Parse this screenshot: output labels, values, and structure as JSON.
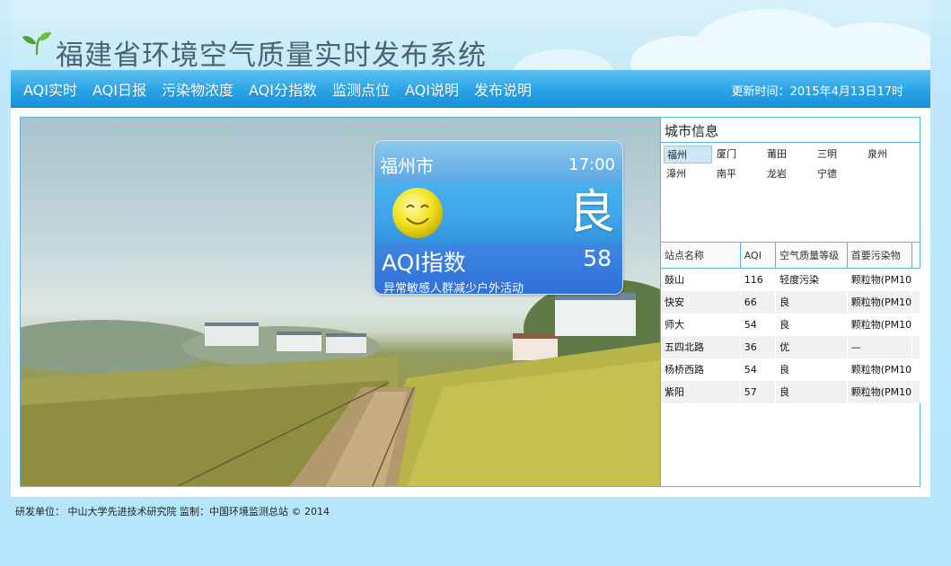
{
  "header": {
    "title": "福建省环境空气质量实时发布系统"
  },
  "nav": {
    "items": [
      {
        "label": "AQI实时"
      },
      {
        "label": "AQI日报"
      },
      {
        "label": "污染物浓度"
      },
      {
        "label": "AQI分指数"
      },
      {
        "label": "监测点位"
      },
      {
        "label": "AQI说明"
      },
      {
        "label": "发布说明"
      }
    ],
    "update_time": "更新时间：2015年4月13日17时"
  },
  "aqi_card": {
    "city": "福州市",
    "time": "17:00",
    "level": "良",
    "aqi_label": "AQI指数",
    "aqi_value": "58",
    "advice": "异常敏感人群减少户外活动",
    "icon": "smiley-face-icon"
  },
  "city_info": {
    "title": "城市信息",
    "cities": [
      [
        "福州",
        "厦门",
        "莆田",
        "三明",
        "泉州"
      ],
      [
        "漳州",
        "南平",
        "龙岩",
        "宁德"
      ]
    ],
    "selected": "福州"
  },
  "stations": {
    "columns": [
      "站点名称",
      "AQI",
      "空气质量等级",
      "首要污染物"
    ],
    "rows": [
      [
        "鼓山",
        "116",
        "轻度污染",
        "颗粒物(PM10"
      ],
      [
        "快安",
        "66",
        "良",
        "颗粒物(PM10"
      ],
      [
        "师大",
        "54",
        "良",
        "颗粒物(PM10"
      ],
      [
        "五四北路",
        "36",
        "优",
        "—"
      ],
      [
        "杨桥西路",
        "54",
        "良",
        "颗粒物(PM10"
      ],
      [
        "紫阳",
        "57",
        "良",
        "颗粒物(PM10"
      ]
    ]
  },
  "footer": {
    "text": "研发单位： 中山大学先进技术研究院    监制：中国环境监测总站    © 2014"
  },
  "colors": {
    "nav_bg": "#2aa3e6",
    "border": "#5bb5dd",
    "title": "#4c6372",
    "page_bg": "#b6e6fb"
  }
}
